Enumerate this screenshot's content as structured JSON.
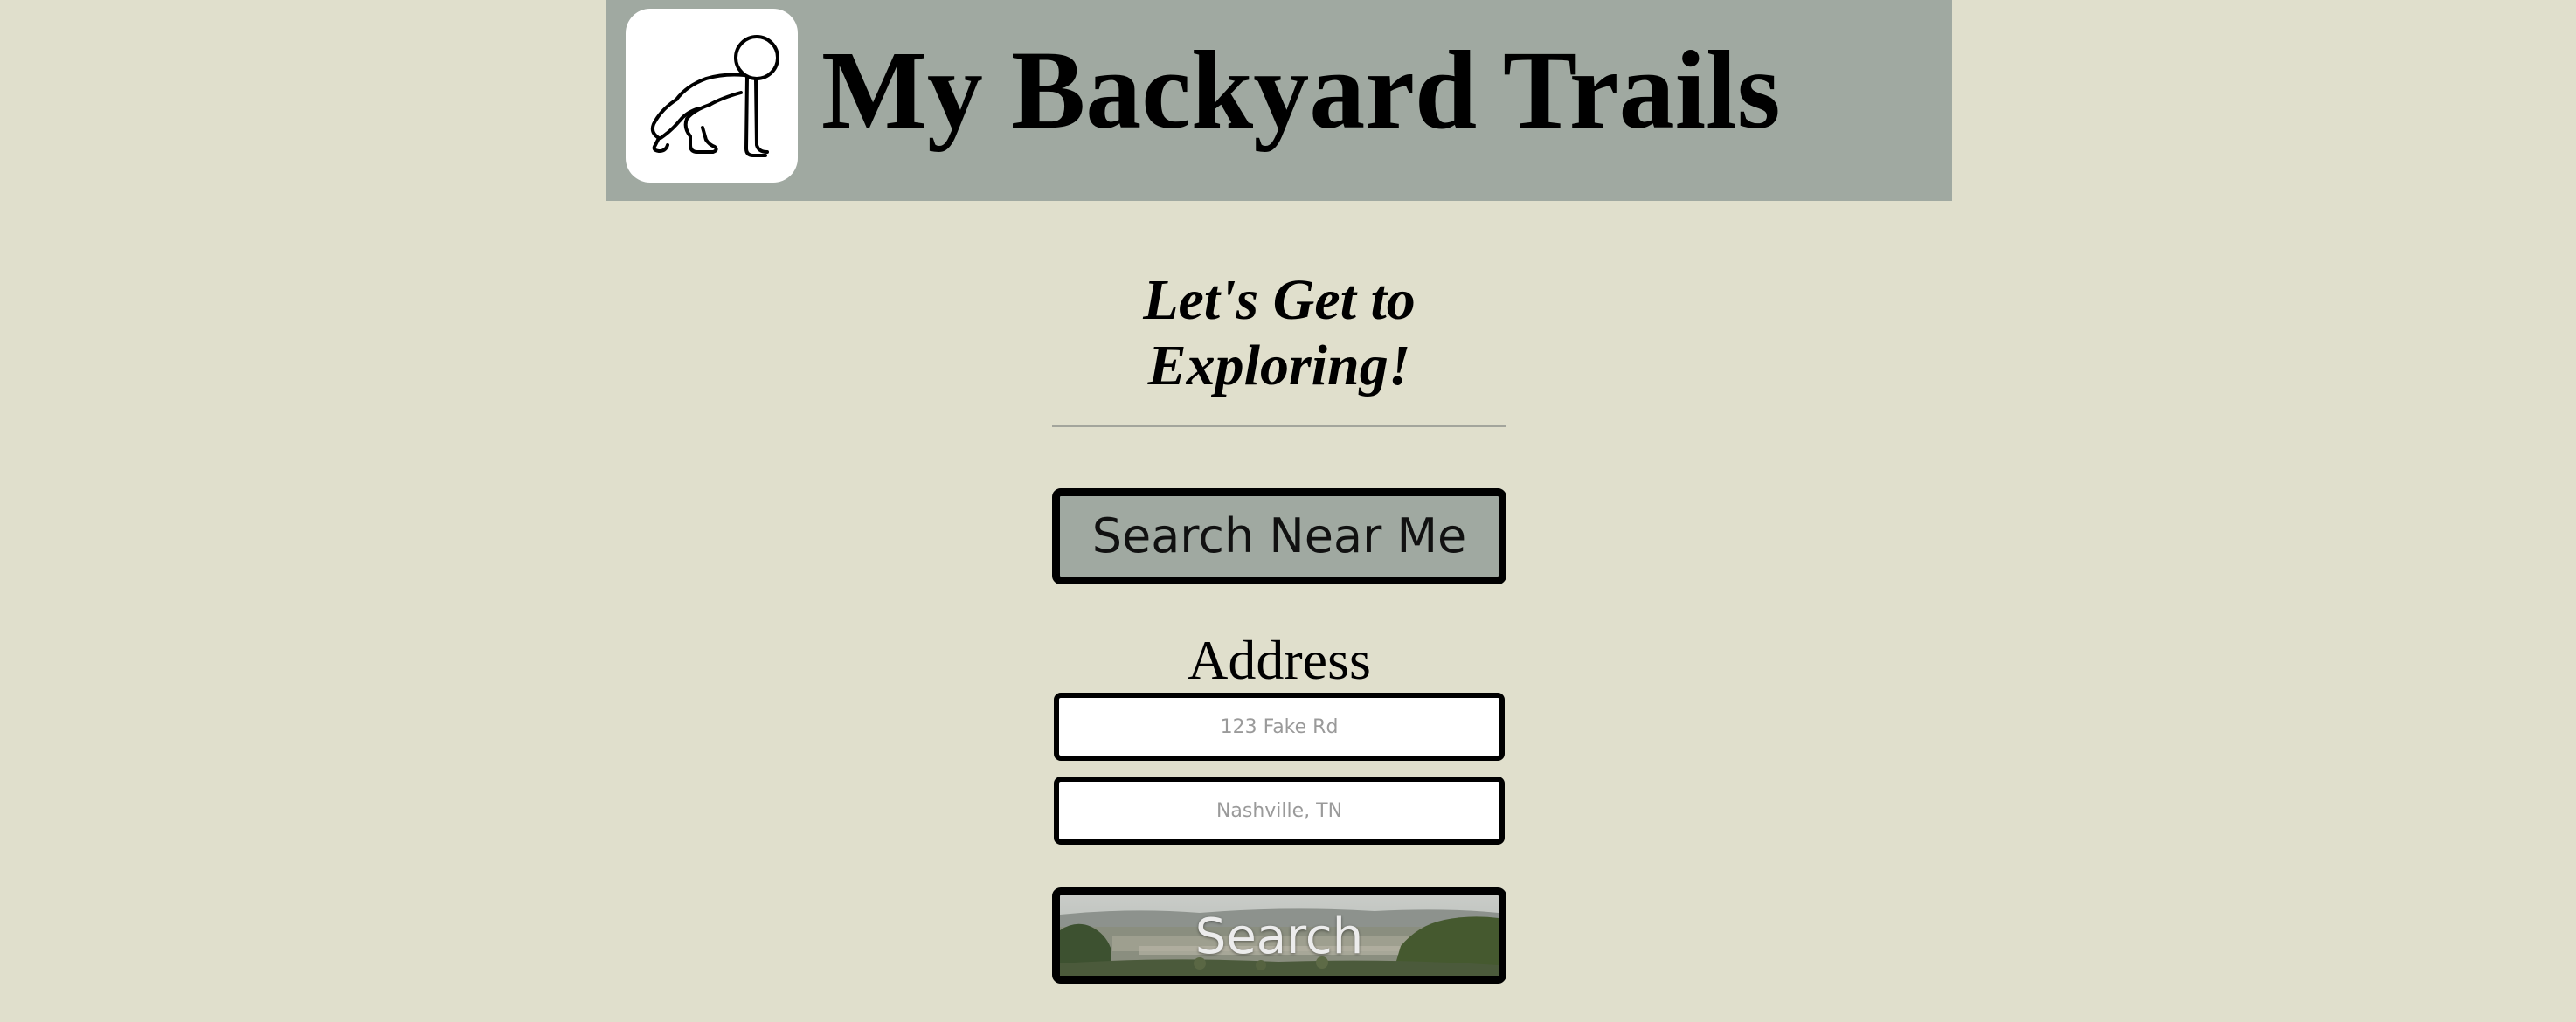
{
  "header": {
    "title": "My Backyard Trails",
    "logo_icon": "crawling-figure-icon",
    "background_color": "#a0a9a1"
  },
  "main": {
    "tagline_line1": "Let's Get to",
    "tagline_line2": "Exploring!",
    "near_me_button_label": "Search Near Me",
    "address_label": "Address",
    "street_field": {
      "placeholder": "123 Fake Rd",
      "value": ""
    },
    "city_field": {
      "placeholder": "Nashville, TN",
      "value": ""
    },
    "search_button_label": "Search"
  },
  "colors": {
    "page_background": "#e0dfcc",
    "accent": "#a0a9a1",
    "border": "#000000"
  }
}
